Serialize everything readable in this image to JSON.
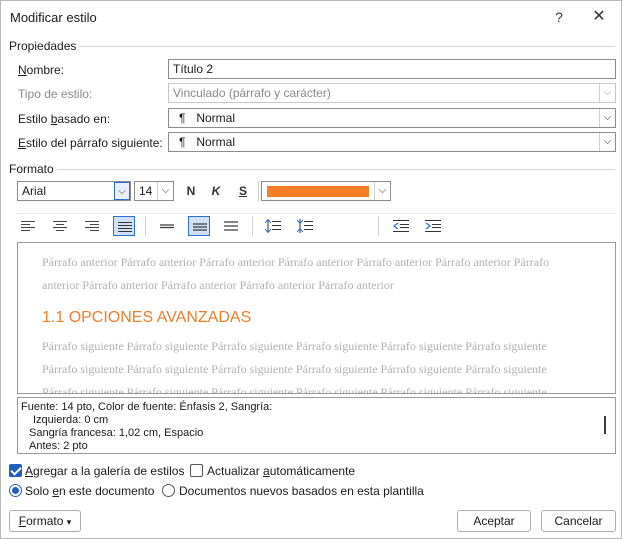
{
  "window": {
    "title": "Modificar estilo",
    "help": "?",
    "close": "✕"
  },
  "properties": {
    "section": "Propiedades",
    "name_label": "Nombre:",
    "name_value": "Título 2",
    "type_label": "Tipo de estilo:",
    "type_value": "Vinculado (párrafo y carácter)",
    "based_label": "Estilo basado en:",
    "based_value": "Normal",
    "next_label": "Estilo del párrafo siguiente:",
    "next_value": "Normal",
    "pilcrow": "¶"
  },
  "format": {
    "section": "Formato",
    "font": "Arial",
    "size": "14",
    "bold": "N",
    "italic": "K",
    "underline": "S",
    "font_color": "#f47f27"
  },
  "preview": {
    "prev_line1": "Párrafo anterior Párrafo anterior Párrafo anterior Párrafo anterior Párrafo anterior Párrafo anterior Párrafo",
    "prev_line2": "anterior Párrafo anterior Párrafo anterior Párrafo anterior Párrafo anterior",
    "heading": "1.1  OPCIONES AVANZADAS",
    "next_line1": "Párrafo siguiente Párrafo siguiente Párrafo siguiente Párrafo siguiente Párrafo siguiente Párrafo siguiente",
    "next_line2": "Párrafo siguiente Párrafo siguiente Párrafo siguiente Párrafo siguiente Párrafo siguiente Párrafo siguiente",
    "next_line3": "Párrafo siguiente Párrafo siguiente Párrafo siguiente Párrafo siguiente Párrafo siguiente Párrafo siguiente"
  },
  "description": {
    "line1": "Fuente: 14 pto, Color de fuente: Énfasis 2, Sangría:",
    "line2": "Izquierda:  0 cm",
    "line3": "Sangría francesa:  1,02 cm, Espacio",
    "line4": "Antes:  2 pto"
  },
  "options": {
    "add_gallery": "Agregar a la galería de estilos",
    "add_gallery_checked": true,
    "auto_update": "Actualizar automáticamente",
    "auto_update_checked": false,
    "only_doc": "Solo en este documento",
    "new_docs": "Documentos nuevos basados en esta plantilla",
    "selected_scope": "only_doc"
  },
  "buttons": {
    "format": "Formato",
    "format_arrow": "▾",
    "accept": "Aceptar",
    "cancel": "Cancelar"
  }
}
